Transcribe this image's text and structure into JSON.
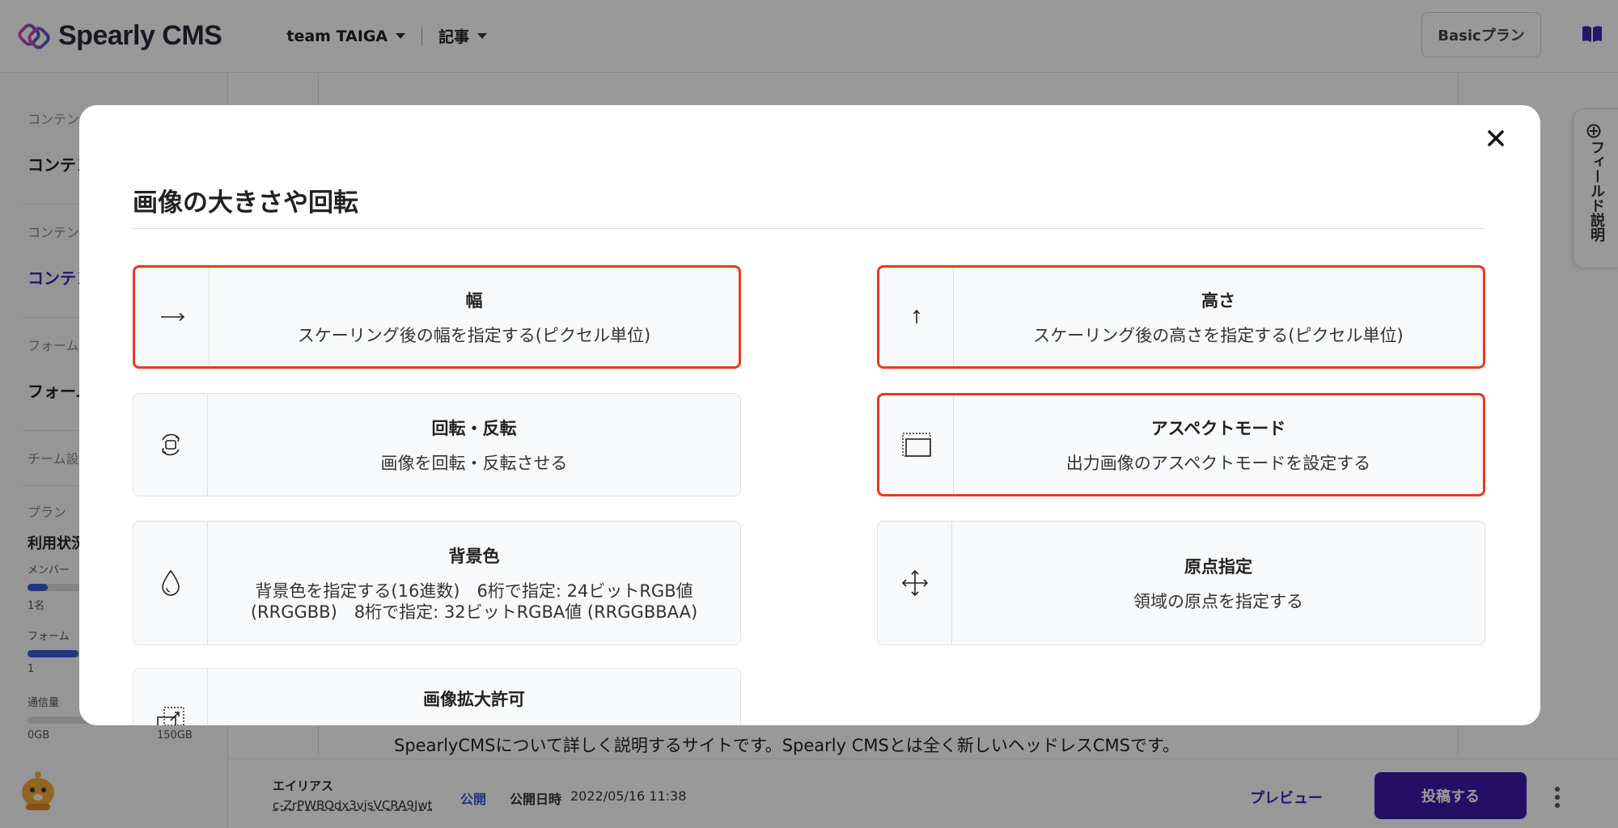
{
  "app": {
    "name": "Spearly CMS",
    "team": "team TAIGA",
    "section": "記事",
    "plan_button": "Basicプラン"
  },
  "sidebar": {
    "group1_label": "コンテン",
    "group1_item": "コンテン",
    "group2_label": "コンテン",
    "group2_item": "コンテン",
    "group3_label": "フォーム",
    "group3_item": "フォーム",
    "team_settings": "チーム設",
    "plan_label": "プラン",
    "usage_title": "利用状況",
    "members_label": "メンバー",
    "members_value": "1名",
    "forms_label": "フォーム",
    "forms_value": "1",
    "traffic_label": "通信量",
    "traffic_min": "0GB",
    "traffic_max": "150GB",
    "members_progress": 0.12,
    "forms_progress": 0.3,
    "traffic_progress": 0.0
  },
  "main": {
    "description": "SpearlyCMSについて詳しく説明するサイトです。Spearly CMSとは全く新しいヘッドレスCMSです。"
  },
  "footer": {
    "alias_label": "エイリアス",
    "alias_value": "c-ZrPWBOdx3vjsVCRA9Jwt",
    "status": "公開",
    "publish_date_label": "公開日時",
    "publish_date": "2022/05/16 11:38",
    "preview": "プレビュー",
    "post": "投稿する"
  },
  "field_tab": {
    "label": "フィールド説明"
  },
  "modal": {
    "title": "画像の大きさや回転",
    "close_icon": "close-icon",
    "cards": [
      {
        "icon": "arrow-right-icon",
        "title": "幅",
        "desc": "スケーリング後の幅を指定する(ピクセル単位)",
        "highlighted": true
      },
      {
        "icon": "arrow-up-icon",
        "title": "高さ",
        "desc": "スケーリング後の高さを指定する(ピクセル単位)",
        "highlighted": true
      },
      {
        "icon": "rotate-icon",
        "title": "回転・反転",
        "desc": "画像を回転・反転させる",
        "highlighted": false
      },
      {
        "icon": "aspect-icon",
        "title": "アスペクトモード",
        "desc": "出力画像のアスペクトモードを設定する",
        "highlighted": true
      },
      {
        "icon": "droplet-icon",
        "title": "背景色",
        "desc": "背景色を指定する(16進数)　6桁で指定: 24ビットRGB値 (RRGGBB)　8桁で指定: 32ビットRGBA値 (RRGGBBAA)",
        "highlighted": false
      },
      {
        "icon": "move-icon",
        "title": "原点指定",
        "desc": "領域の原点を指定する",
        "highlighted": false
      },
      {
        "icon": "upscale-icon",
        "title": "画像拡大許可",
        "desc": "",
        "highlighted": false
      }
    ]
  },
  "colors": {
    "accent": "#3b1aa8",
    "highlight": "#e83a1e",
    "link": "#3a55d0"
  }
}
